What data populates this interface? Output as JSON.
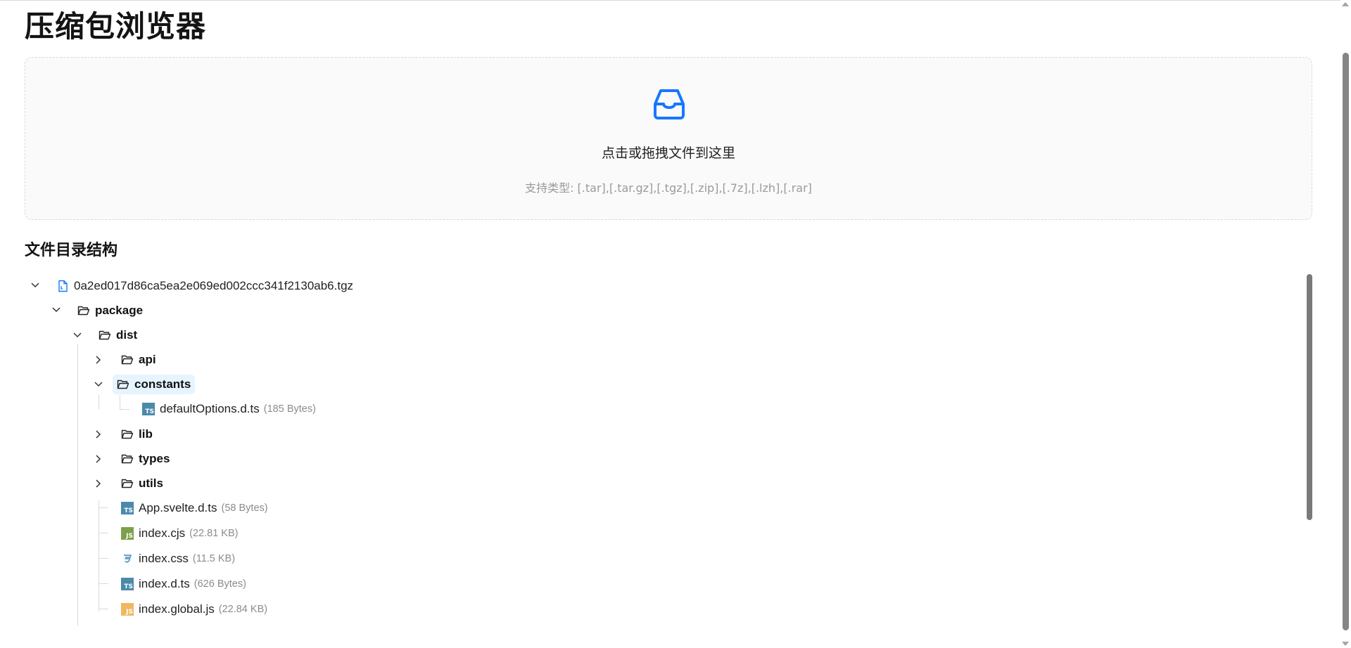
{
  "page": {
    "title": "压缩包浏览器"
  },
  "upload": {
    "text": "点击或拖拽文件到这里",
    "hint": "支持类型: [.tar],[.tar.gz],[.tgz],[.zip],[.7z],[.lzh],[.rar]",
    "icon": "inbox-icon",
    "accent": "#1677ff"
  },
  "tree_section": {
    "title": "文件目录结构"
  },
  "tree": {
    "root": {
      "name": "0a2ed017d86ca5ea2e069ed002ccc341f2130ab6.tgz",
      "icon": "file-icon",
      "expanded": true
    },
    "package": {
      "name": "package",
      "icon": "folder-open-icon",
      "expanded": true
    },
    "dist": {
      "name": "dist",
      "icon": "folder-open-icon",
      "expanded": true
    },
    "api": {
      "name": "api",
      "icon": "folder-open-icon",
      "expanded": false
    },
    "constants": {
      "name": "constants",
      "icon": "folder-open-icon",
      "expanded": true,
      "selected": true
    },
    "defaultOptions": {
      "name": "defaultOptions.d.ts",
      "size": "(185 Bytes)",
      "icon": "typescript-file-icon"
    },
    "lib": {
      "name": "lib",
      "icon": "folder-open-icon",
      "expanded": false
    },
    "types": {
      "name": "types",
      "icon": "folder-open-icon",
      "expanded": false
    },
    "utils": {
      "name": "utils",
      "icon": "folder-open-icon",
      "expanded": false
    },
    "app_svelte": {
      "name": "App.svelte.d.ts",
      "size": "(58 Bytes)",
      "icon": "typescript-file-icon"
    },
    "index_cjs": {
      "name": "index.cjs",
      "size": "(22.81 KB)",
      "icon": "nodejs-file-icon"
    },
    "index_css": {
      "name": "index.css",
      "size": "(11.5 KB)",
      "icon": "css-file-icon"
    },
    "index_dts": {
      "name": "index.d.ts",
      "size": "(626 Bytes)",
      "icon": "typescript-file-icon"
    },
    "index_global": {
      "name": "index.global.js",
      "size": "(22.84 KB)",
      "icon": "javascript-file-icon"
    }
  },
  "colors": {
    "ts": "#4a8aaa",
    "node_js": "#7da14a",
    "css": "#5a9bc4",
    "js": "#f0b860",
    "selected_bg": "#e6f4ff"
  }
}
